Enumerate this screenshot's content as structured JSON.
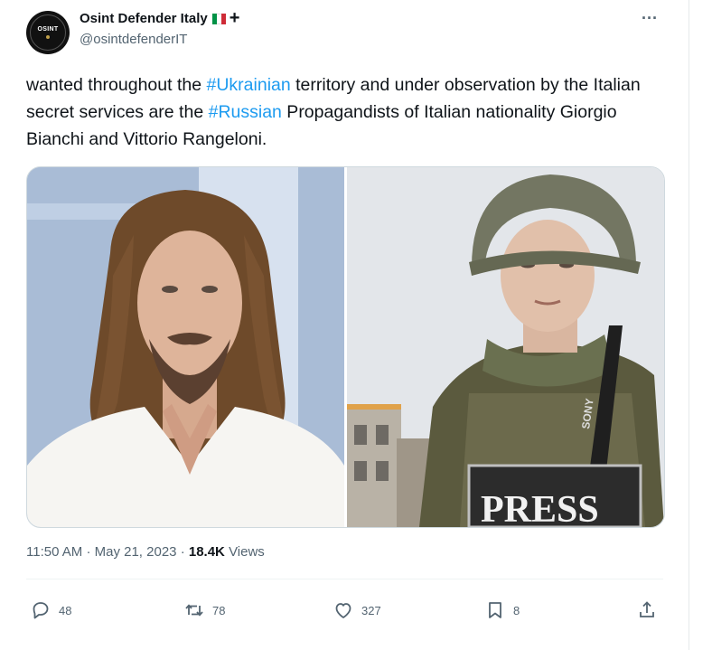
{
  "author": {
    "avatar_text": "OSINT",
    "display_name": "Osint Defender Italy",
    "flag_colors": [
      "#009246",
      "#ffffff",
      "#ce2b37"
    ],
    "handle": "@osintdefenderIT"
  },
  "tweet": {
    "text_parts": {
      "p1": "wanted throughout the ",
      "hashtag1": "#Ukrainian",
      "p2": " territory and under observation by the Italian secret services are the ",
      "hashtag2": "#Russian",
      "p3": " Propagandists of Italian nationality Giorgio Bianchi and Vittorio Rangeloni."
    },
    "press_label": "PRESS",
    "camera_brand": "SONY"
  },
  "meta": {
    "time": "11:50 AM",
    "separator": "·",
    "date": "May 21, 2023",
    "views_count": "18.4K",
    "views_label": "Views"
  },
  "actions": {
    "replies": "48",
    "reposts": "78",
    "likes": "327",
    "bookmarks": "8"
  },
  "colors": {
    "accent": "#1d9bf0",
    "text": "#0f1419",
    "secondary": "#536471"
  }
}
